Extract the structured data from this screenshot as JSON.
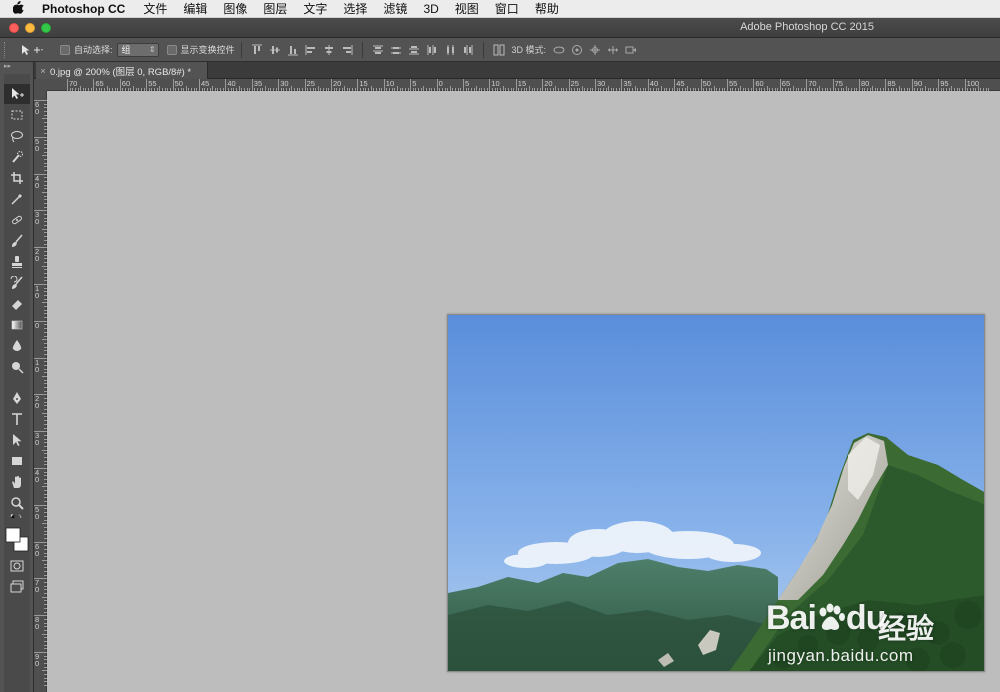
{
  "menubar": {
    "app_name": "Photoshop CC",
    "items": [
      "文件",
      "编辑",
      "图像",
      "图层",
      "文字",
      "选择",
      "滤镜",
      "3D",
      "视图",
      "窗口",
      "帮助"
    ]
  },
  "window": {
    "title": "Adobe Photoshop CC 2015"
  },
  "options": {
    "auto_select_label": "自动选择:",
    "auto_select_value": "组",
    "show_transform_label": "显示变换控件",
    "mode_3d_label": "3D 模式:"
  },
  "document_tab": {
    "close_glyph": "×",
    "title": "0.jpg @ 200% (图层 0, RGB/8#) *"
  },
  "rulers": {
    "horizontal_labels": [
      "70",
      "65",
      "60",
      "55",
      "50",
      "45",
      "40",
      "35",
      "30",
      "25",
      "20",
      "15",
      "10",
      "5",
      "0",
      "5",
      "10",
      "15",
      "20",
      "25",
      "30",
      "35",
      "40",
      "45",
      "50",
      "55",
      "60",
      "65",
      "70",
      "75",
      "80",
      "85",
      "90",
      "95",
      "100"
    ],
    "vertical_labels": [
      "60",
      "50",
      "40",
      "30",
      "20",
      "10",
      "0",
      "10",
      "20",
      "30",
      "40",
      "50",
      "60",
      "70",
      "80",
      "90"
    ]
  },
  "tools": [
    "move-tool",
    "marquee-tool",
    "lasso-tool",
    "quick-select-tool",
    "crop-tool",
    "eyedropper-tool",
    "healing-brush-tool",
    "brush-tool",
    "clone-stamp-tool",
    "history-brush-tool",
    "eraser-tool",
    "gradient-tool",
    "blur-tool",
    "dodge-tool",
    "pen-tool",
    "type-tool",
    "path-select-tool",
    "shape-tool",
    "hand-tool",
    "zoom-tool"
  ],
  "watermark": {
    "brand": "Bai",
    "brand_tail": "du",
    "cn": "经验",
    "url": "jingyan.baidu.com"
  },
  "colors": {
    "ui_dark": "#535353",
    "canvas_bg": "#bdbdbd",
    "sky_top": "#5b8fdc",
    "sky_bottom": "#a9c9ee",
    "mountain": "#2f5a34"
  }
}
